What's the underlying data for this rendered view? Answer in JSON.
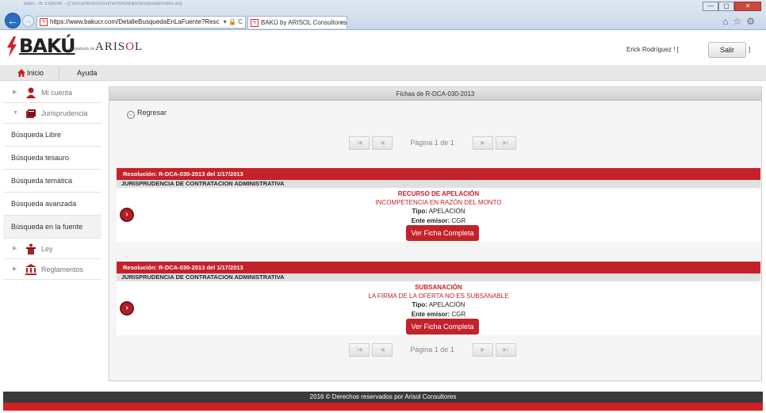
{
  "browser": {
    "title_strip": "Baku - IE Explorer - Q:\\documents\\Documento\\Detalle\\Busqueda\\index.asp",
    "address": "https://www.bakucr.com/DetalleBusquedaEnLaFuente?Resc",
    "address_tools": "▾ 🔒 C",
    "tab_title": "BAKÚ by ARISOL Consultores",
    "tab_close": "×",
    "back": "←",
    "forward": "→",
    "win_min": "—",
    "win_max": "▢",
    "win_close": "✕",
    "icons": "⌂☆⚙"
  },
  "header": {
    "brand": "BAKÚ",
    "tagline": "un producto de",
    "company_pre": "ARIS",
    "company_o": "O",
    "company_post": "L",
    "user": "Erick Rodríguez ! [",
    "logout_label": "Salir",
    "bracket": "]"
  },
  "menu": {
    "home": "Inicio",
    "help": "Ayuda"
  },
  "sidebar": {
    "account": "Mi cuenta",
    "jurisprudence": "Jurisprudencia",
    "links": [
      "Búsqueda Libre",
      "Búsqueda tesauro",
      "Búsqueda temática",
      "Búsqueda avanzada",
      "Búsqueda en la fuente"
    ],
    "law": "Ley",
    "regulations": "Reglamentos"
  },
  "panel": {
    "title": "Fichas de R-DCA-030-2013",
    "back_label": "Regresar",
    "pager_text": "Página 1 de 1",
    "first": "|◀",
    "prev": "◀",
    "next": "▶",
    "last": "▶|"
  },
  "cards": [
    {
      "head": "Resolución:  R-DCA-030-2013   del  1/17/2013",
      "sub": "JURISPRUDENCIA DE CONTRATACION ADMINISTRATIVA",
      "title": "RECURSO DE APELACIÓN",
      "desc": "INCOMPETENCIA EN RAZÓN DEL MONTO",
      "tipo_label": "Tipo:",
      "tipo": "APELACIÓN",
      "ente_label": "Ente emisor:",
      "ente": "CGR",
      "button": "Ver Ficha Completa"
    },
    {
      "head": "Resolución:  R-DCA-030-2013   del  1/17/2013",
      "sub": "JURISPRUDENCIA DE CONTRATACION ADMINISTRATIVA",
      "title": "SUBSANACIÓN",
      "desc": "LA FIRMA DE LA OFERTA NO ES SUBSANABLE",
      "tipo_label": "Tipo:",
      "tipo": "APELACIÓN",
      "ente_label": "Ente emisor:",
      "ente": "CGR",
      "button": "Ver Ficha Completa"
    }
  ],
  "footer": {
    "text": "2016 © Derechos reservados por Arisol Consultores"
  },
  "colors": {
    "brand_red": "#c4222a",
    "footer_dark": "#3a3a3a"
  }
}
